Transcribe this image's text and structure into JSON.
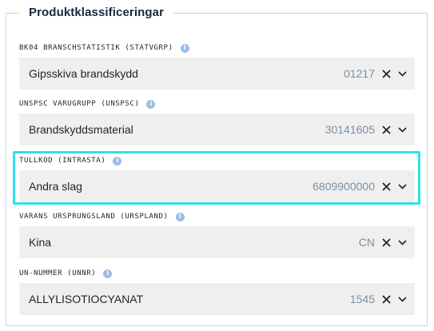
{
  "section": {
    "title": "Produktklassificeringar"
  },
  "fields": [
    {
      "label": "BK04 BRANSCHSTATISTIK (STATVGRP)",
      "value": "Gipsskiva brandskydd",
      "code": "01217"
    },
    {
      "label": "UNSPSC VARUGRUPP (UNSPSC)",
      "value": "Brandskyddsmaterial",
      "code": "30141605"
    },
    {
      "label": "TULLKOD (INTRASTA)",
      "value": "Andra slag",
      "code": "6809900000"
    },
    {
      "label": "VARANS URSPRUNGSLAND (URSPLAND)",
      "value": "Kina",
      "code": "CN"
    },
    {
      "label": "UN-NUMMER (UNNR)",
      "value": "ALLYLISOTIOCYANAT",
      "code": "1545"
    }
  ],
  "icons": {
    "info": "info-icon",
    "clear": "close-icon",
    "dropdown": "chevron-down-icon"
  },
  "colors": {
    "highlight": "#2ee0ee",
    "info_icon": "#9dbde5",
    "code_text": "#7a8fa6",
    "field_bg": "#efefef"
  }
}
